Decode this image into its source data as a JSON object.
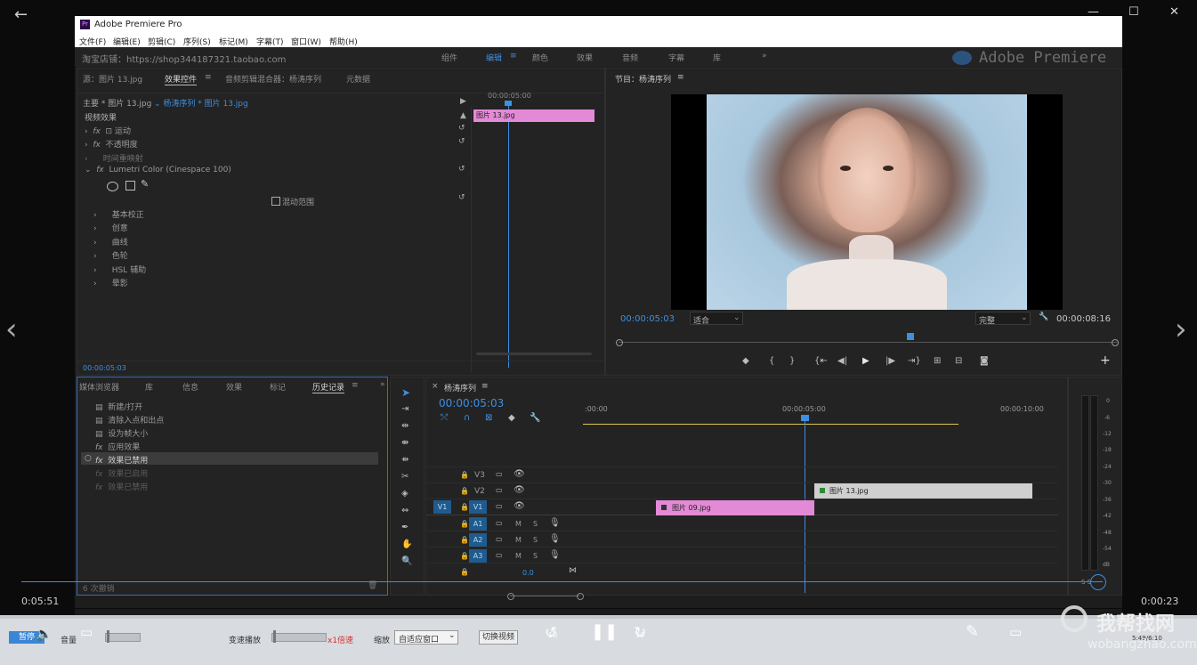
{
  "player": {
    "time_current": "0:05:51",
    "time_remaining": "0:00:23",
    "nav_prev": "‹",
    "nav_next": "›",
    "window_controls": {
      "minimize": "—",
      "maximize": "☐",
      "close": "✕"
    }
  },
  "premiere": {
    "title": "Adobe Premiere Pro",
    "menu": [
      "文件(F)",
      "编辑(E)",
      "剪辑(C)",
      "序列(S)",
      "标记(M)",
      "字幕(T)",
      "窗口(W)",
      "帮助(H)"
    ],
    "watermark_shop": "淘宝店铺：https://shop344187321.taobao.com",
    "workspaces": [
      "组件",
      "编辑",
      "颜色",
      "效果",
      "音频",
      "字幕",
      "库"
    ],
    "workspace_more": "»",
    "brand_watermark": "Adobe Premiere"
  },
  "effect_controls": {
    "tabs": [
      "源：图片 13.jpg",
      "效果控件",
      "音频剪辑混合器：杨涛序列",
      "元数据"
    ],
    "source_label": "主要 * 图片 13.jpg",
    "sequence_label": "杨涛序列 * 图片 13.jpg",
    "timecode_ruler": "00:00:05:00",
    "section": "视频效果",
    "effects": [
      "运动",
      "不透明度",
      "时间重映射",
      "Lumetri Color (Cinespace 100)"
    ],
    "mask_option": "混动范围",
    "lumetri_groups": [
      "基本校正",
      "创意",
      "曲线",
      "色轮",
      "HSL 辅助",
      "晕影"
    ],
    "clip_label": "图片 13.jpg",
    "footer_time": "00:00:05:03"
  },
  "program": {
    "title": "节目：杨涛序列",
    "timecode": "00:00:05:03",
    "fit": "适合",
    "quality": "完整",
    "duration": "00:00:08:16",
    "add": "+"
  },
  "history": {
    "tabs": [
      "媒体浏览器",
      "库",
      "信息",
      "效果",
      "标记",
      "历史记录"
    ],
    "more": "»",
    "items": [
      "新建/打开",
      "清除入点和出点",
      "设为帧大小",
      "应用效果",
      "效果已禁用",
      "效果已启用",
      "效果已禁用"
    ],
    "footer": "6 次撤销"
  },
  "timeline": {
    "title": "杨涛序列",
    "timecode": "00:00:05:03",
    "ruler": [
      ":00:00",
      "00:00:05:00",
      "00:00:10:00"
    ],
    "video_tracks": [
      "V3",
      "V2",
      "V1"
    ],
    "audio_tracks": [
      "A1",
      "A2",
      "A3"
    ],
    "source_patch": "V1",
    "master_value": "0.0",
    "clips": [
      {
        "name": "图片 13.jpg",
        "track": "V2"
      },
      {
        "name": "图片 09.jpg",
        "track": "V1"
      }
    ],
    "meter_scale": [
      "0",
      "-6",
      "-12",
      "-18",
      "-24",
      "-30",
      "-36",
      "-42",
      "-48",
      "-54",
      "dB"
    ],
    "meter_footer": "S S"
  },
  "bottom_bar": {
    "pause": "暂停",
    "volume": "音量",
    "speed": "变速播放",
    "speed_value": "x1倍速",
    "zoom": "缩放",
    "zoom_value": "自适应窗口",
    "switch": "切换视频",
    "rewind": "10",
    "forward": "30",
    "site": "我帮找网",
    "site_url": "wobangzhao.com",
    "small_time": "5:49/6:10"
  }
}
